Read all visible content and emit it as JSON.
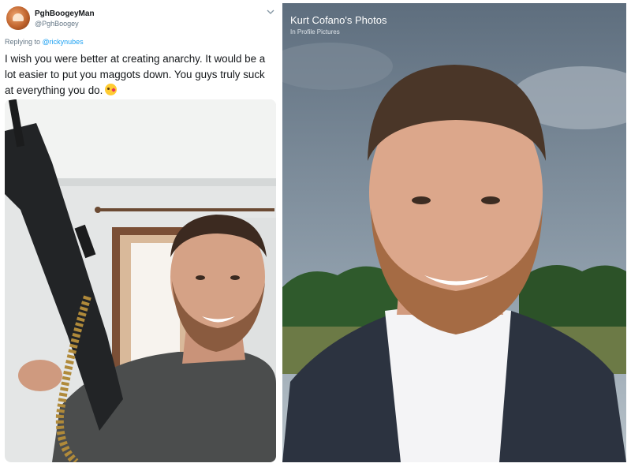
{
  "tweet": {
    "display_name": "PghBoogeyMan",
    "handle": "@PghBoogey",
    "reply_prefix": "Replying to ",
    "reply_to": "@rickynubes",
    "text": "I wish you were better at creating anarchy. It would be a lot easier to put you maggots down. You guys truly suck at everything you do.",
    "emoji": "kissing-face-heart-emoji",
    "menu_icon": "chevron-down-icon"
  },
  "right_panel": {
    "title": "Kurt Cofano's Photos",
    "subtitle": "In Profile Pictures"
  },
  "colors": {
    "link": "#1da1f2",
    "text": "#14171a",
    "muted": "#657786",
    "background": "#ffffff"
  }
}
